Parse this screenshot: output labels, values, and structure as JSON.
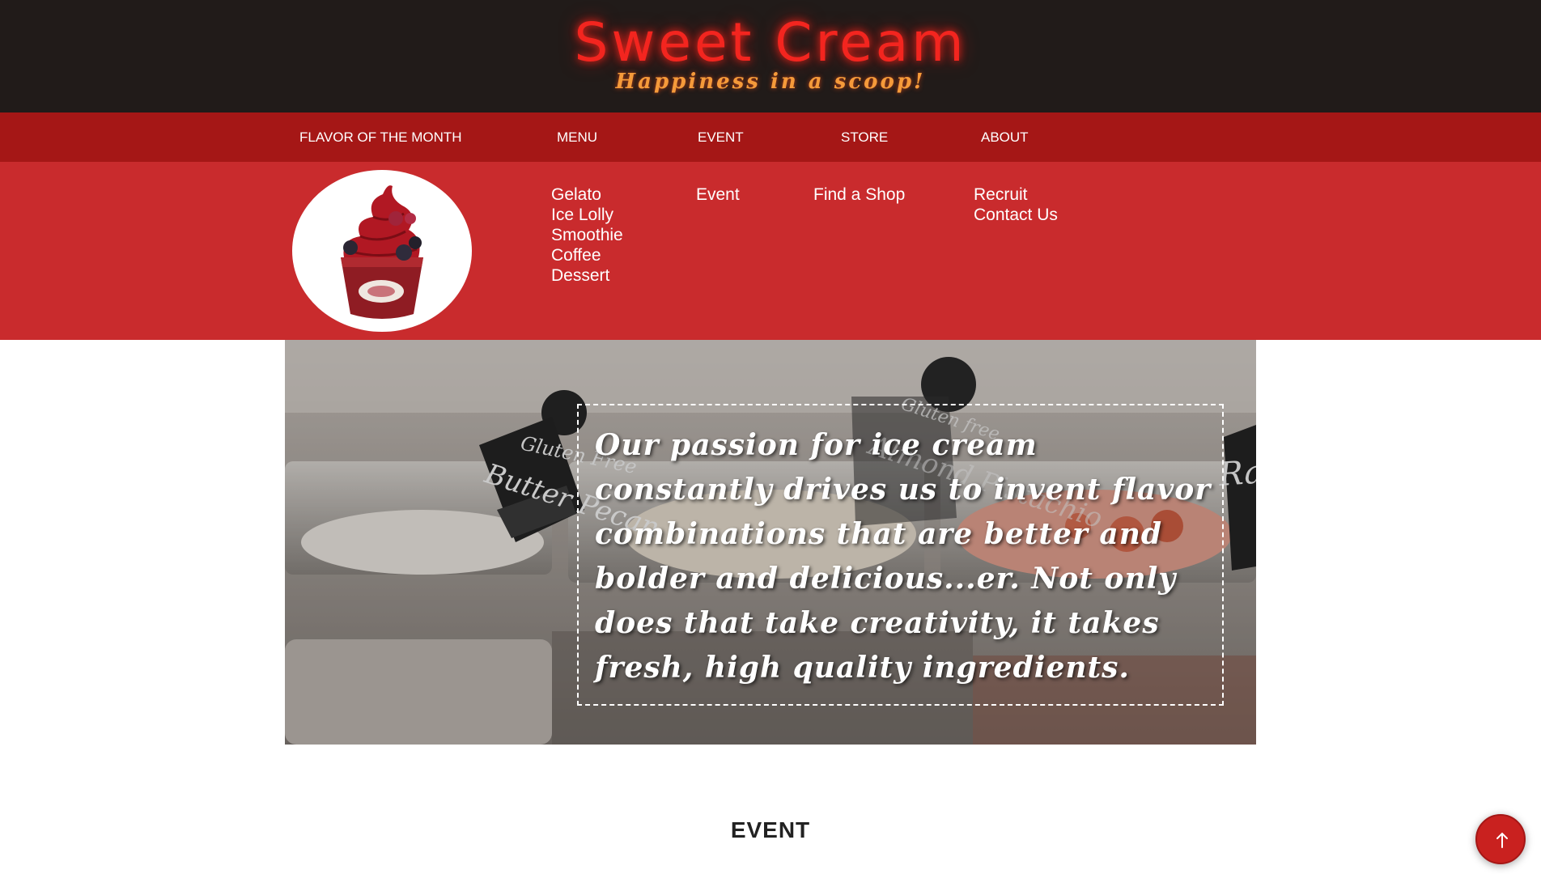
{
  "header": {
    "title": "Sweet Cream",
    "tagline": "Happiness in a scoop!"
  },
  "nav": {
    "flavor_of_the_month": "FLAVOR OF THE MONTH",
    "menu": "MENU",
    "event": "EVENT",
    "store": "STORE",
    "about": "ABOUT"
  },
  "mega_menu": {
    "menu_items": [
      "Gelato",
      "Ice Lolly",
      "Smoothie",
      "Coffee",
      "Dessert"
    ],
    "event_items": [
      "Event"
    ],
    "store_items": [
      "Find a Shop"
    ],
    "about_items": [
      "Recruit",
      "Contact Us"
    ]
  },
  "hero": {
    "quote": "Our passion for ice cream constantly drives us to invent flavor combinations that are better and bolder and delicious...er. Not only does that take creativity, it takes fresh, high quality ingredients.",
    "signs": {
      "left_top": "Gluten Free",
      "left_bottom": "Butter Pecan",
      "center_top": "Gluten free",
      "center_bottom": "Almond Pistachio",
      "right": "Ras"
    }
  },
  "event_section": {
    "heading": "EVENT"
  },
  "icons": {
    "scroll_top": "arrow-up-icon"
  },
  "colors": {
    "header_bg": "#211b19",
    "nav_bg": "#a51716",
    "mega_menu_bg": "#c92b2d",
    "brand_red": "#f3251f",
    "tagline_orange": "#f59a3a",
    "button_red": "#c9211f"
  }
}
